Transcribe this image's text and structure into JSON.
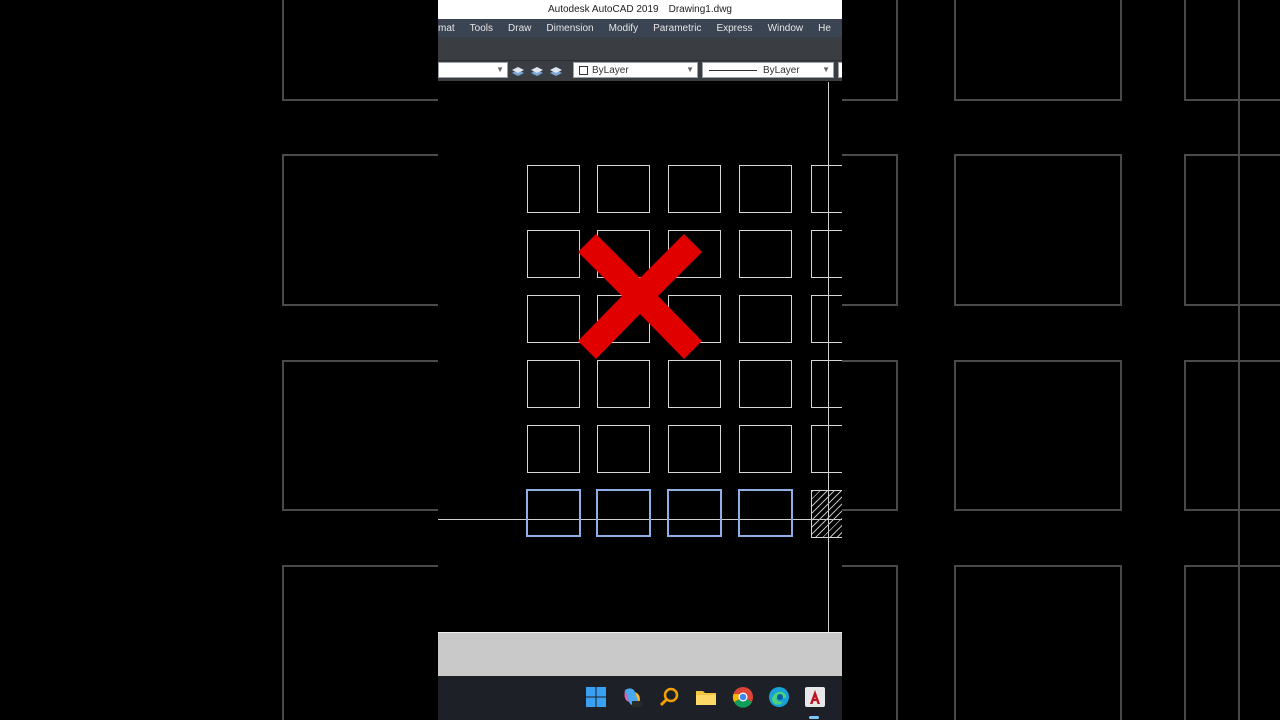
{
  "window": {
    "app_title": "Autodesk AutoCAD 2019",
    "file_name": "Drawing1.dwg"
  },
  "menu": [
    "mat",
    "Tools",
    "Draw",
    "Dimension",
    "Modify",
    "Parametric",
    "Express",
    "Window",
    "He"
  ],
  "toolbar": {
    "color_combo": "ByLayer",
    "linetype_combo": "ByLayer"
  },
  "icons": {
    "layer_tools": [
      "layer-match-icon",
      "layer-previous-icon",
      "layer-state-icon"
    ],
    "taskbar": [
      "windows-start-icon",
      "copilot-icon",
      "search-icon",
      "file-explorer-icon",
      "chrome-icon",
      "edge-icon",
      "autocad-icon"
    ]
  },
  "colors": {
    "overlay_x": "#e00000",
    "selection": "#8fb0e6",
    "titlebar": "#ffffff",
    "menubar": "#3b4453",
    "command_line": "#c9c9c9"
  }
}
